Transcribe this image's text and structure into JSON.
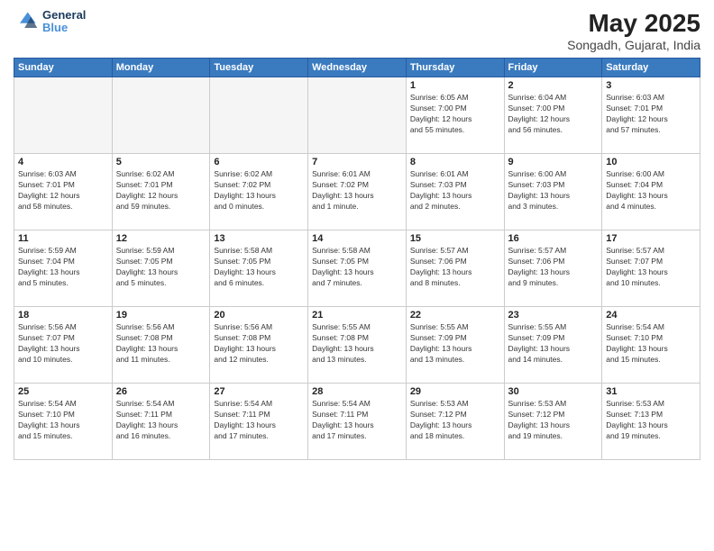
{
  "logo": {
    "line1": "General",
    "line2": "Blue"
  },
  "title": "May 2025",
  "subtitle": "Songadh, Gujarat, India",
  "weekdays": [
    "Sunday",
    "Monday",
    "Tuesday",
    "Wednesday",
    "Thursday",
    "Friday",
    "Saturday"
  ],
  "weeks": [
    [
      {
        "day": "",
        "info": ""
      },
      {
        "day": "",
        "info": ""
      },
      {
        "day": "",
        "info": ""
      },
      {
        "day": "",
        "info": ""
      },
      {
        "day": "1",
        "info": "Sunrise: 6:05 AM\nSunset: 7:00 PM\nDaylight: 12 hours\nand 55 minutes."
      },
      {
        "day": "2",
        "info": "Sunrise: 6:04 AM\nSunset: 7:00 PM\nDaylight: 12 hours\nand 56 minutes."
      },
      {
        "day": "3",
        "info": "Sunrise: 6:03 AM\nSunset: 7:01 PM\nDaylight: 12 hours\nand 57 minutes."
      }
    ],
    [
      {
        "day": "4",
        "info": "Sunrise: 6:03 AM\nSunset: 7:01 PM\nDaylight: 12 hours\nand 58 minutes."
      },
      {
        "day": "5",
        "info": "Sunrise: 6:02 AM\nSunset: 7:01 PM\nDaylight: 12 hours\nand 59 minutes."
      },
      {
        "day": "6",
        "info": "Sunrise: 6:02 AM\nSunset: 7:02 PM\nDaylight: 13 hours\nand 0 minutes."
      },
      {
        "day": "7",
        "info": "Sunrise: 6:01 AM\nSunset: 7:02 PM\nDaylight: 13 hours\nand 1 minute."
      },
      {
        "day": "8",
        "info": "Sunrise: 6:01 AM\nSunset: 7:03 PM\nDaylight: 13 hours\nand 2 minutes."
      },
      {
        "day": "9",
        "info": "Sunrise: 6:00 AM\nSunset: 7:03 PM\nDaylight: 13 hours\nand 3 minutes."
      },
      {
        "day": "10",
        "info": "Sunrise: 6:00 AM\nSunset: 7:04 PM\nDaylight: 13 hours\nand 4 minutes."
      }
    ],
    [
      {
        "day": "11",
        "info": "Sunrise: 5:59 AM\nSunset: 7:04 PM\nDaylight: 13 hours\nand 5 minutes."
      },
      {
        "day": "12",
        "info": "Sunrise: 5:59 AM\nSunset: 7:05 PM\nDaylight: 13 hours\nand 5 minutes."
      },
      {
        "day": "13",
        "info": "Sunrise: 5:58 AM\nSunset: 7:05 PM\nDaylight: 13 hours\nand 6 minutes."
      },
      {
        "day": "14",
        "info": "Sunrise: 5:58 AM\nSunset: 7:05 PM\nDaylight: 13 hours\nand 7 minutes."
      },
      {
        "day": "15",
        "info": "Sunrise: 5:57 AM\nSunset: 7:06 PM\nDaylight: 13 hours\nand 8 minutes."
      },
      {
        "day": "16",
        "info": "Sunrise: 5:57 AM\nSunset: 7:06 PM\nDaylight: 13 hours\nand 9 minutes."
      },
      {
        "day": "17",
        "info": "Sunrise: 5:57 AM\nSunset: 7:07 PM\nDaylight: 13 hours\nand 10 minutes."
      }
    ],
    [
      {
        "day": "18",
        "info": "Sunrise: 5:56 AM\nSunset: 7:07 PM\nDaylight: 13 hours\nand 10 minutes."
      },
      {
        "day": "19",
        "info": "Sunrise: 5:56 AM\nSunset: 7:08 PM\nDaylight: 13 hours\nand 11 minutes."
      },
      {
        "day": "20",
        "info": "Sunrise: 5:56 AM\nSunset: 7:08 PM\nDaylight: 13 hours\nand 12 minutes."
      },
      {
        "day": "21",
        "info": "Sunrise: 5:55 AM\nSunset: 7:08 PM\nDaylight: 13 hours\nand 13 minutes."
      },
      {
        "day": "22",
        "info": "Sunrise: 5:55 AM\nSunset: 7:09 PM\nDaylight: 13 hours\nand 13 minutes."
      },
      {
        "day": "23",
        "info": "Sunrise: 5:55 AM\nSunset: 7:09 PM\nDaylight: 13 hours\nand 14 minutes."
      },
      {
        "day": "24",
        "info": "Sunrise: 5:54 AM\nSunset: 7:10 PM\nDaylight: 13 hours\nand 15 minutes."
      }
    ],
    [
      {
        "day": "25",
        "info": "Sunrise: 5:54 AM\nSunset: 7:10 PM\nDaylight: 13 hours\nand 15 minutes."
      },
      {
        "day": "26",
        "info": "Sunrise: 5:54 AM\nSunset: 7:11 PM\nDaylight: 13 hours\nand 16 minutes."
      },
      {
        "day": "27",
        "info": "Sunrise: 5:54 AM\nSunset: 7:11 PM\nDaylight: 13 hours\nand 17 minutes."
      },
      {
        "day": "28",
        "info": "Sunrise: 5:54 AM\nSunset: 7:11 PM\nDaylight: 13 hours\nand 17 minutes."
      },
      {
        "day": "29",
        "info": "Sunrise: 5:53 AM\nSunset: 7:12 PM\nDaylight: 13 hours\nand 18 minutes."
      },
      {
        "day": "30",
        "info": "Sunrise: 5:53 AM\nSunset: 7:12 PM\nDaylight: 13 hours\nand 19 minutes."
      },
      {
        "day": "31",
        "info": "Sunrise: 5:53 AM\nSunset: 7:13 PM\nDaylight: 13 hours\nand 19 minutes."
      }
    ]
  ]
}
